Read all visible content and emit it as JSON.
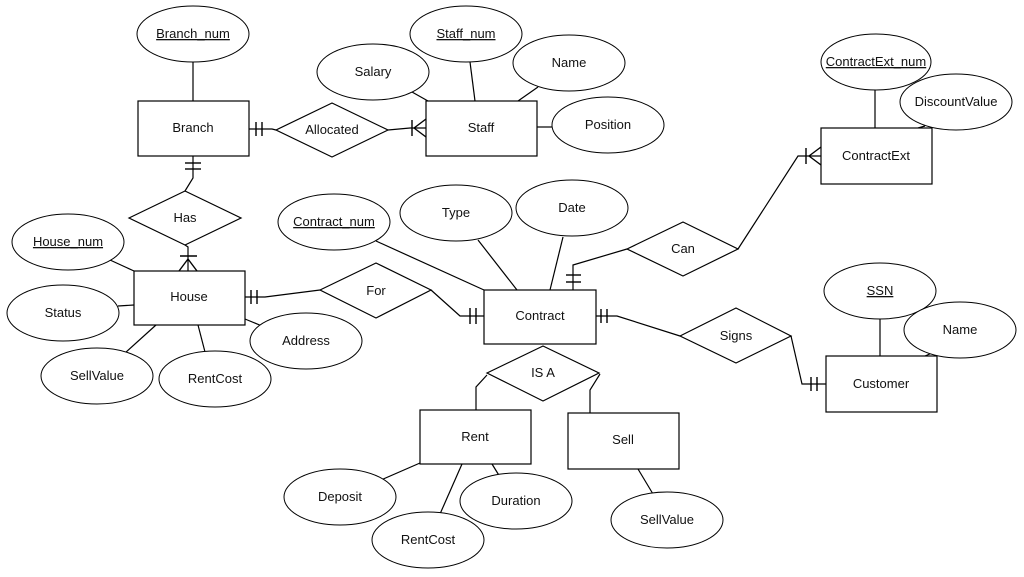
{
  "diagram": {
    "type": "er-diagram",
    "entities": [
      {
        "id": "branch",
        "label": "Branch"
      },
      {
        "id": "staff",
        "label": "Staff"
      },
      {
        "id": "house",
        "label": "House"
      },
      {
        "id": "contract",
        "label": "Contract"
      },
      {
        "id": "contractext",
        "label": "ContractExt"
      },
      {
        "id": "customer",
        "label": "Customer"
      },
      {
        "id": "rent",
        "label": "Rent"
      },
      {
        "id": "sell",
        "label": "Sell"
      }
    ],
    "relationships": [
      {
        "id": "allocated",
        "label": "Allocated",
        "from": "branch",
        "to": "staff",
        "from_card": "one-and-only-one",
        "to_card": "one-or-many"
      },
      {
        "id": "has",
        "label": "Has",
        "from": "branch",
        "to": "house",
        "from_card": "one-and-only-one",
        "to_card": "one-or-many"
      },
      {
        "id": "for",
        "label": "For",
        "from": "house",
        "to": "contract",
        "from_card": "one-and-only-one",
        "to_card": "one-and-only-one"
      },
      {
        "id": "can",
        "label": "Can",
        "from": "contract",
        "to": "contractext",
        "from_card": "one-and-only-one",
        "to_card": "one-or-many"
      },
      {
        "id": "signs",
        "label": "Signs",
        "from": "contract",
        "to": "customer",
        "from_card": "one-and-only-one",
        "to_card": "one-and-only-one"
      },
      {
        "id": "isa",
        "label": "IS A",
        "from": "contract",
        "to": [
          "rent",
          "sell"
        ]
      }
    ],
    "attributes": {
      "branch": [
        {
          "label": "Branch_num",
          "key": true
        }
      ],
      "staff": [
        {
          "label": "Staff_num",
          "key": true
        },
        {
          "label": "Salary",
          "key": false
        },
        {
          "label": "Name",
          "key": false
        },
        {
          "label": "Position",
          "key": false
        }
      ],
      "house": [
        {
          "label": "House_num",
          "key": true
        },
        {
          "label": "Status",
          "key": false
        },
        {
          "label": "SellValue",
          "key": false
        },
        {
          "label": "RentCost",
          "key": false
        },
        {
          "label": "Address",
          "key": false
        }
      ],
      "contract": [
        {
          "label": "Contract_num",
          "key": true
        },
        {
          "label": "Type",
          "key": false
        },
        {
          "label": "Date",
          "key": false
        }
      ],
      "contractext": [
        {
          "label": "ContractExt_num",
          "key": true
        },
        {
          "label": "DiscountValue",
          "key": false
        }
      ],
      "customer": [
        {
          "label": "SSN",
          "key": true
        },
        {
          "label": "Name",
          "key": false
        }
      ],
      "rent": [
        {
          "label": "Deposit",
          "key": false
        },
        {
          "label": "RentCost",
          "key": false
        },
        {
          "label": "Duration",
          "key": false
        }
      ],
      "sell": [
        {
          "label": "SellValue",
          "key": false
        }
      ]
    }
  }
}
